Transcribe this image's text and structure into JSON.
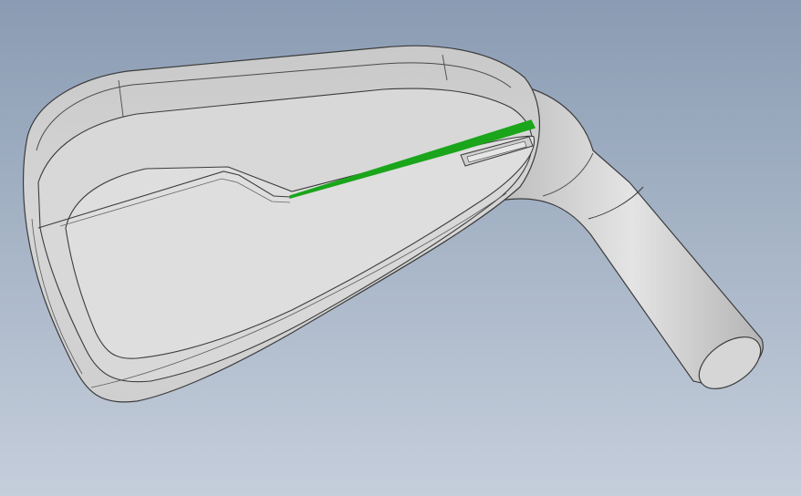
{
  "viewport": {
    "background_top": "#8a9cb3",
    "background_bottom": "#c5cedb"
  },
  "model": {
    "body_color": "#d2d2d2",
    "face_color": "#dedede",
    "hosel_color": "#c8c8c8",
    "edge_color": "#3c3c3c",
    "highlight_color": "#1aa51a"
  }
}
